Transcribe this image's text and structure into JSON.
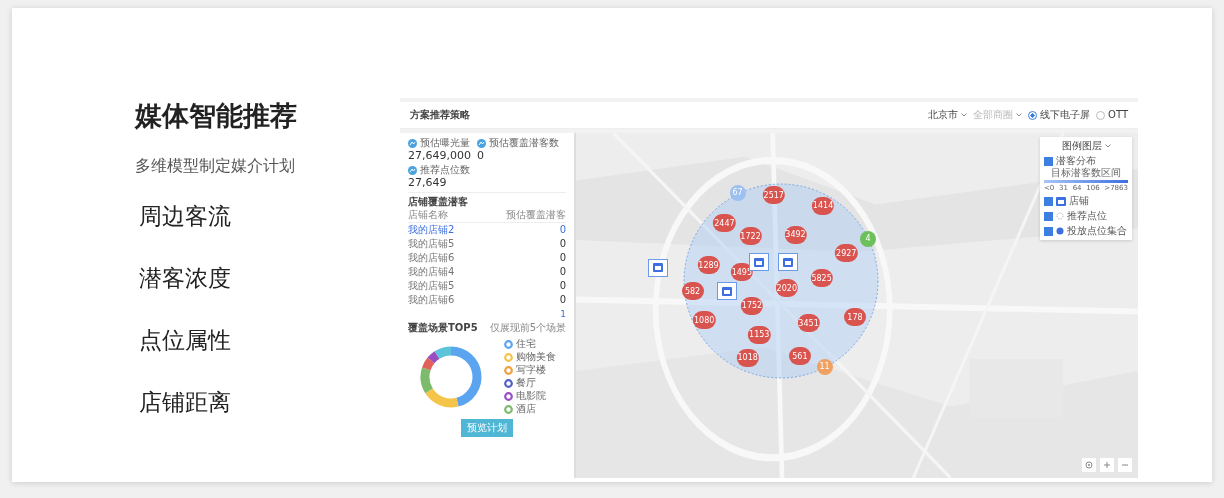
{
  "intro": {
    "title": "媒体智能推荐",
    "subtitle": "多维模型制定媒介计划",
    "features": [
      "周边客流",
      "潜客浓度",
      "点位属性",
      "店铺距离"
    ]
  },
  "app": {
    "title": "方案推荐策略",
    "toolbar": {
      "city": "北京市",
      "district": "全部商圈",
      "options": [
        {
          "label": "线下电子屏",
          "selected": true
        },
        {
          "label": "OTT",
          "selected": false
        }
      ]
    },
    "stats": [
      {
        "label": "预估曝光量",
        "value": "27,649,000"
      },
      {
        "label": "预估覆盖潜客数",
        "value": "0"
      },
      {
        "label": "推荐点位数",
        "value": "27,649"
      }
    ],
    "stores": {
      "title": "店铺覆盖潜客",
      "columns": [
        "店铺名称",
        "预估覆盖潜客"
      ],
      "rows": [
        {
          "name": "我的店铺2",
          "value": "0",
          "selected": true
        },
        {
          "name": "我的店铺5",
          "value": "0",
          "selected": false
        },
        {
          "name": "我的店铺6",
          "value": "0",
          "selected": false
        },
        {
          "name": "我的店铺4",
          "value": "0",
          "selected": false
        },
        {
          "name": "我的店铺5",
          "value": "0",
          "selected": false
        },
        {
          "name": "我的店铺6",
          "value": "0",
          "selected": false
        }
      ],
      "page": "1"
    },
    "scenes": {
      "title": "覆盖场景TOP5",
      "note": "仅展现前5个场景",
      "items": [
        {
          "label": "住宅",
          "color": "#5ba4f0"
        },
        {
          "label": "购物美食",
          "color": "#f5c54a"
        },
        {
          "label": "写字楼",
          "color": "#f0a040"
        },
        {
          "label": "餐厅",
          "color": "#5060c8"
        },
        {
          "label": "电影院",
          "color": "#9a4fc0"
        },
        {
          "label": "酒店",
          "color": "#7cbb6c"
        }
      ]
    },
    "button": "预览计划",
    "legend": {
      "title": "图例图层",
      "items": [
        {
          "kind": "heat",
          "label": "潜客分布",
          "checked": true,
          "scale_title": "目标潜客数区间",
          "ticks": [
            "<0",
            "31",
            "64",
            "106",
            ">7863"
          ]
        },
        {
          "kind": "store",
          "label": "店铺",
          "checked": true
        },
        {
          "kind": "point",
          "label": "推荐点位",
          "checked": true
        },
        {
          "kind": "dot",
          "label": "投放点位集合",
          "checked": true
        }
      ]
    },
    "markers": [
      {
        "kind": "count",
        "label": "2517"
      },
      {
        "kind": "count",
        "label": "1414"
      },
      {
        "kind": "count",
        "label": "2447"
      },
      {
        "kind": "count",
        "label": "1722"
      },
      {
        "kind": "count",
        "label": "3492"
      },
      {
        "kind": "count",
        "label": "1289"
      },
      {
        "kind": "count",
        "label": "1495"
      },
      {
        "kind": "count",
        "label": "5825"
      },
      {
        "kind": "count",
        "label": "2927"
      },
      {
        "kind": "count",
        "label": "582"
      },
      {
        "kind": "count",
        "label": "1752"
      },
      {
        "kind": "count",
        "label": "2020"
      },
      {
        "kind": "count",
        "label": "1080"
      },
      {
        "kind": "count",
        "label": "1153"
      },
      {
        "kind": "count",
        "label": "3451"
      },
      {
        "kind": "count",
        "label": "178"
      },
      {
        "kind": "count",
        "label": "1018"
      },
      {
        "kind": "count",
        "label": "561"
      },
      {
        "kind": "store"
      },
      {
        "kind": "store"
      },
      {
        "kind": "store"
      },
      {
        "kind": "store"
      },
      {
        "kind": "small",
        "label": "4",
        "color": "#6cc05a"
      },
      {
        "kind": "small",
        "label": "11",
        "color": "#f0a060"
      },
      {
        "kind": "small",
        "label": "67",
        "color": "#9cc0f0"
      }
    ]
  }
}
